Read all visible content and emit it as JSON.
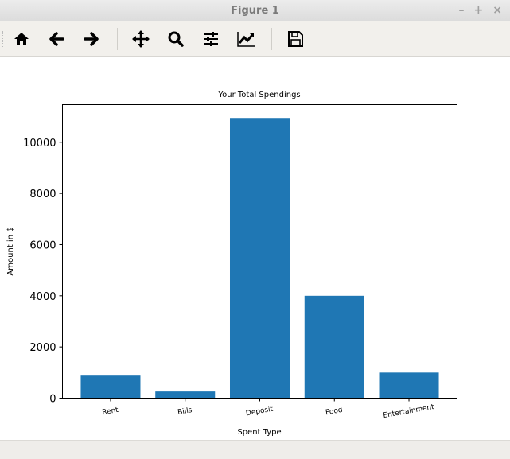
{
  "window": {
    "title": "Figure 1",
    "controls": [
      "minimize",
      "maximize",
      "close"
    ]
  },
  "toolbar": {
    "icons": [
      "home-icon",
      "back-arrow-icon",
      "forward-arrow-icon",
      "pan-icon",
      "zoom-icon",
      "configure-subplots-icon",
      "edit-axis-icon",
      "save-icon"
    ]
  },
  "chart_data": {
    "type": "bar",
    "title": "Your Total Spendings",
    "xlabel": "Spent Type",
    "ylabel": "Amount in $",
    "categories": [
      "Rent",
      "Bills",
      "Deposit",
      "Food",
      "Entertainment"
    ],
    "values": [
      880,
      260,
      10950,
      4000,
      1000
    ],
    "ylim": [
      0,
      11470
    ],
    "yticks": [
      0,
      2000,
      4000,
      6000,
      8000,
      10000
    ],
    "ytick_labels": [
      "0",
      "2000",
      "4000",
      "6000",
      "8000",
      "10000"
    ],
    "xtick_rotation": 10,
    "bar_color": "#1f77b4",
    "grid": false,
    "legend": "none"
  }
}
